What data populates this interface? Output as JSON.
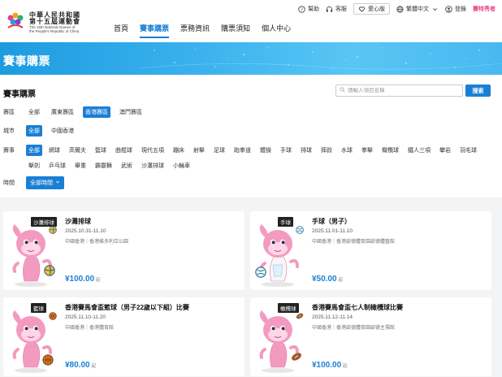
{
  "header": {
    "logo_cn_line1": "中華人民共和國",
    "logo_cn_line2": "第十五屆運動會",
    "logo_en_line1": "The 15th National Games of",
    "logo_en_line2": "the People's Republic of China",
    "utils": {
      "help": "幫助",
      "service": "客服",
      "care": "愛心版",
      "language": "繁體中文",
      "login": "登錄",
      "brand": "賽特秀者"
    },
    "nav": [
      {
        "label": "首頁",
        "active": false
      },
      {
        "label": "賽事購票",
        "active": true
      },
      {
        "label": "票務資訊",
        "active": false
      },
      {
        "label": "購票須知",
        "active": false
      },
      {
        "label": "個人中心",
        "active": false
      }
    ]
  },
  "banner": {
    "title": "賽事購票"
  },
  "filters": {
    "section_title": "賽事購票",
    "search_placeholder": "請輸入項目名稱",
    "search_button": "搜索",
    "region_label": "賽區",
    "regions": [
      {
        "label": "全部",
        "selected": false
      },
      {
        "label": "廣東賽區",
        "selected": false
      },
      {
        "label": "香港賽區",
        "selected": true
      },
      {
        "label": "澳門賽區",
        "selected": false
      }
    ],
    "city_label": "城市",
    "cities": [
      {
        "label": "全部",
        "selected": true
      },
      {
        "label": "中國香港",
        "selected": false
      }
    ],
    "event_label": "賽事",
    "events": [
      {
        "label": "全部",
        "selected": true
      },
      {
        "label": "網球"
      },
      {
        "label": "高爾夫"
      },
      {
        "label": "籃球"
      },
      {
        "label": "曲棍球"
      },
      {
        "label": "現代五項"
      },
      {
        "label": "蹦床"
      },
      {
        "label": "射擊"
      },
      {
        "label": "足球"
      },
      {
        "label": "跆拳道"
      },
      {
        "label": "體操"
      },
      {
        "label": "手球"
      },
      {
        "label": "排球"
      },
      {
        "label": "摔跤"
      },
      {
        "label": "水球"
      },
      {
        "label": "拳擊"
      },
      {
        "label": "橄欖球"
      },
      {
        "label": "鐵人三項"
      },
      {
        "label": "攀岩"
      },
      {
        "label": "羽毛球"
      },
      {
        "label": "擊劍"
      },
      {
        "label": "乒乓球"
      },
      {
        "label": "舉重"
      },
      {
        "label": "霹靂舞"
      },
      {
        "label": "武術"
      },
      {
        "label": "沙灘排球"
      },
      {
        "label": "小輪車"
      }
    ],
    "time_label": "時間",
    "time_value": "全部時間"
  },
  "cards": [
    {
      "tag": "沙灘排球",
      "name": "沙灘排球",
      "date": "2025.10.31-11.10",
      "venue": "中國香港｜香港維多利亞公園",
      "price": "¥100.00",
      "unit": "起",
      "ball": "volleyball"
    },
    {
      "tag": "手球",
      "name": "手球（男子）",
      "date": "2025.11.01-11.10",
      "venue": "中國香港｜香港啟德體育園啟德體藝館",
      "price": "¥50.00",
      "unit": "起",
      "ball": "handball"
    },
    {
      "tag": "籃球",
      "name": "香港賽馬會盃籃球（男子22歲以下組）比賽",
      "date": "2025.11.10-11.20",
      "venue": "中國香港｜香港體育館",
      "price": "¥80.00",
      "unit": "起",
      "ball": "basketball"
    },
    {
      "tag": "橄欖球",
      "name": "香港賽馬會盃七人制橄欖球比賽",
      "date": "2025.11.12-11.14",
      "venue": "中國香港｜香港啟德體育園啟德主場館",
      "price": "¥100.00",
      "unit": "起",
      "ball": "rugby"
    }
  ],
  "colors": {
    "accent": "#1a7fd4",
    "mascot_pink": "#f39ac0",
    "banner": "#3bb2ee"
  }
}
